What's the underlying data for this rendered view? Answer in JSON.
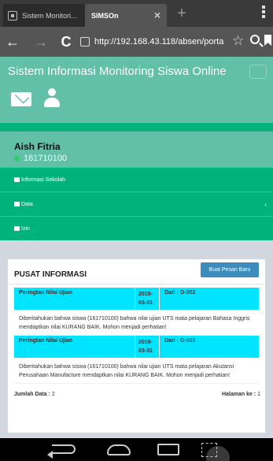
{
  "browser": {
    "tabs": [
      {
        "label": "Sistem Monitori...",
        "active": false
      },
      {
        "label": "SIMSOn",
        "active": true
      }
    ],
    "url": "http://192.168.43.118/absen/porta"
  },
  "app": {
    "brand": "Sistem Informasi Monitoring Siswa Online",
    "colors": {
      "header": "#62bfa8",
      "accent": "#00b37a",
      "message_header": "#00e5ff",
      "button": "#3c8dbc"
    }
  },
  "user": {
    "name": "Aish Fitria",
    "id": "161710100"
  },
  "menu": {
    "items": [
      {
        "label": "Informasi Sekolah",
        "icon": "bank-icon"
      },
      {
        "label": "Data",
        "icon": "table-icon",
        "caret": "‹"
      },
      {
        "label": "Izin",
        "icon": "bank-icon"
      }
    ]
  },
  "info": {
    "title": "PUSAT INFORMASI",
    "new_button": "Buat Pesan Baru",
    "messages": [
      {
        "title": "Peringtan Nilai Ujian",
        "date": "2019-03-31",
        "from": "Dari : G-002",
        "body": "Diberitahukan bahwa siswa (161710100) bahwa nilai ujian UTS mata pelajaran Bahasa Inggris mendaptkan nilai KURANG BAIK. Mohon menjadi perhatian!"
      },
      {
        "title": "Peringtan Nilai Ujian",
        "date": "2019-03-31",
        "from": "Dari : G-003",
        "body": "Diberitahukan bahwa siswa (161710100) bahwa nilai ujian UTS mata pelajaran Akutansi Perusahaan Manufacture mendaptkan nilai KURANG BAIK. Mohon menjadi perhatian!"
      }
    ],
    "footer": {
      "total_label": "Jumlah Data :",
      "total_value": "2",
      "page_label": "Halaman ke :",
      "page_value": "1"
    }
  }
}
